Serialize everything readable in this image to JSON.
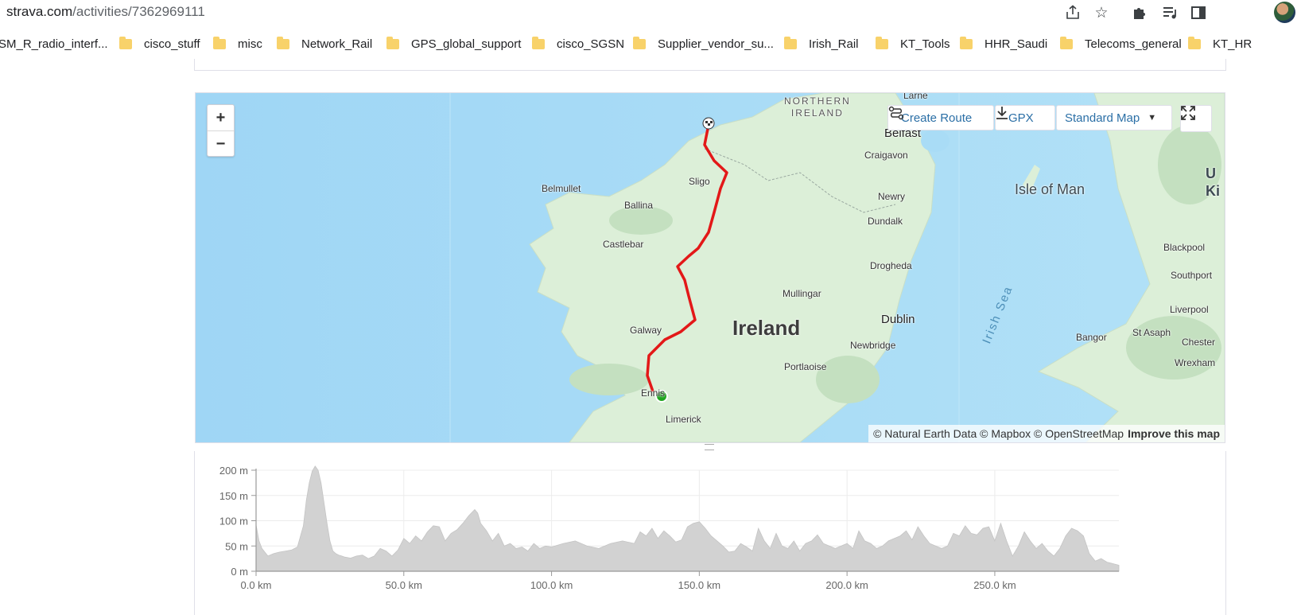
{
  "browser": {
    "url_domain": "strava.com",
    "url_path": "/activities/7362969111",
    "icons": [
      "share-icon",
      "star-icon",
      "extensions-icon",
      "reading-list-icon",
      "side-panel-icon",
      "profile-avatar"
    ]
  },
  "bookmarks": [
    {
      "label": "SM_R_radio_interf...",
      "folder": false
    },
    {
      "label": "cisco_stuff",
      "folder": true
    },
    {
      "label": "misc",
      "folder": true
    },
    {
      "label": "Network_Rail",
      "folder": true
    },
    {
      "label": "GPS_global_support",
      "folder": true
    },
    {
      "label": "cisco_SGSN",
      "folder": true
    },
    {
      "label": "Supplier_vendor_su...",
      "folder": true
    },
    {
      "label": "Irish_Rail",
      "folder": true
    },
    {
      "label": "KT_Tools",
      "folder": true
    },
    {
      "label": "HHR_Saudi",
      "folder": true
    },
    {
      "label": "Telecoms_general",
      "folder": true
    },
    {
      "label": "KT_HR",
      "folder": true
    }
  ],
  "map": {
    "zoom_in": "+",
    "zoom_out": "−",
    "create_route": "Create Route",
    "gpx": "GPX",
    "map_style": "Standard Map",
    "attribution": "© Natural Earth Data © Mapbox © OpenStreetMap",
    "improve": "Improve this map",
    "labels": {
      "ireland": "Ireland",
      "isle_of_man": "Isle of Man",
      "northern_ireland": "NORTHERN\nIRELAND",
      "irish_sea": "Irish Sea",
      "dublin": "Dublin",
      "galway": "Galway",
      "limerick": "Limerick",
      "ennis": "Ennis",
      "belfast": "Belfast",
      "larne": "Larne",
      "craigavon": "Craigavon",
      "newry": "Newry",
      "dundalk": "Dundalk",
      "drogheda": "Drogheda",
      "mullingar": "Mullingar",
      "newbridge": "Newbridge",
      "portlaoise": "Portlaoise",
      "sligo": "Sligo",
      "ballina": "Ballina",
      "belmullet": "Belmullet",
      "castlebar": "Castlebar",
      "blackpool": "Blackpool",
      "southport": "Southport",
      "liverpool": "Liverpool",
      "bangor": "Bangor",
      "st_asaph": "St Asaph",
      "chester": "Chester",
      "wrexham": "Wrexham",
      "uk_partial": "U\nKi"
    },
    "colors": {
      "route": "#e31818",
      "start": "#1fa51f",
      "water": "#a9dcf6",
      "land": "#dcefd8"
    }
  },
  "chart_data": {
    "type": "area",
    "xlabel": "",
    "ylabel": "",
    "xlim": [
      0,
      292
    ],
    "ylim": [
      0,
      200
    ],
    "x_ticks": [
      0,
      50,
      100,
      150,
      200,
      250
    ],
    "x_tick_labels": [
      "0.0 km",
      "50.0 km",
      "100.0 km",
      "150.0 km",
      "200.0 km",
      "250.0 km"
    ],
    "y_ticks": [
      0,
      50,
      100,
      150,
      200
    ],
    "y_tick_labels": [
      "0 m",
      "50 m",
      "100 m",
      "150 m",
      "200 m"
    ],
    "grid": true,
    "fill_color": "#d2d2d2",
    "x": [
      0,
      1,
      2,
      4,
      6,
      8,
      10,
      12,
      14,
      16,
      17,
      18,
      19,
      20,
      21,
      22,
      23,
      24,
      25,
      26,
      27,
      28,
      29,
      30,
      32,
      34,
      36,
      38,
      40,
      42,
      44,
      46,
      48,
      50,
      52,
      54,
      56,
      58,
      60,
      62,
      64,
      66,
      68,
      70,
      72,
      74,
      75,
      76,
      78,
      80,
      82,
      84,
      86,
      88,
      90,
      92,
      94,
      96,
      98,
      100,
      104,
      108,
      112,
      116,
      120,
      124,
      128,
      130,
      132,
      134,
      136,
      138,
      140,
      142,
      144,
      146,
      148,
      150,
      152,
      154,
      156,
      158,
      160,
      162,
      164,
      166,
      168,
      170,
      172,
      174,
      176,
      178,
      180,
      182,
      184,
      186,
      188,
      190,
      192,
      194,
      196,
      198,
      200,
      202,
      204,
      206,
      208,
      210,
      212,
      214,
      216,
      218,
      220,
      222,
      224,
      226,
      228,
      230,
      232,
      234,
      236,
      238,
      240,
      242,
      244,
      246,
      248,
      250,
      252,
      254,
      256,
      258,
      260,
      262,
      264,
      266,
      268,
      270,
      272,
      274,
      276,
      278,
      280,
      282,
      284,
      286,
      288,
      290,
      292
    ],
    "values": [
      92,
      60,
      45,
      30,
      35,
      38,
      40,
      42,
      48,
      90,
      140,
      175,
      198,
      208,
      200,
      175,
      135,
      95,
      60,
      40,
      35,
      32,
      30,
      28,
      26,
      30,
      32,
      25,
      30,
      45,
      40,
      30,
      42,
      65,
      55,
      70,
      60,
      78,
      90,
      88,
      60,
      75,
      82,
      95,
      110,
      122,
      115,
      95,
      80,
      60,
      75,
      50,
      55,
      45,
      48,
      40,
      55,
      45,
      50,
      48,
      55,
      60,
      50,
      45,
      55,
      60,
      55,
      78,
      70,
      85,
      65,
      80,
      70,
      58,
      62,
      88,
      95,
      98,
      85,
      70,
      60,
      50,
      38,
      40,
      55,
      48,
      40,
      85,
      60,
      45,
      75,
      50,
      45,
      60,
      40,
      55,
      60,
      72,
      55,
      50,
      45,
      50,
      55,
      45,
      80,
      60,
      55,
      45,
      50,
      60,
      65,
      70,
      80,
      62,
      88,
      70,
      55,
      50,
      45,
      50,
      75,
      70,
      90,
      75,
      72,
      85,
      88,
      60,
      95,
      60,
      30,
      50,
      78,
      60,
      45,
      55,
      40,
      30,
      45,
      70,
      85,
      80,
      70,
      35,
      20,
      25,
      18,
      15,
      12
    ]
  }
}
